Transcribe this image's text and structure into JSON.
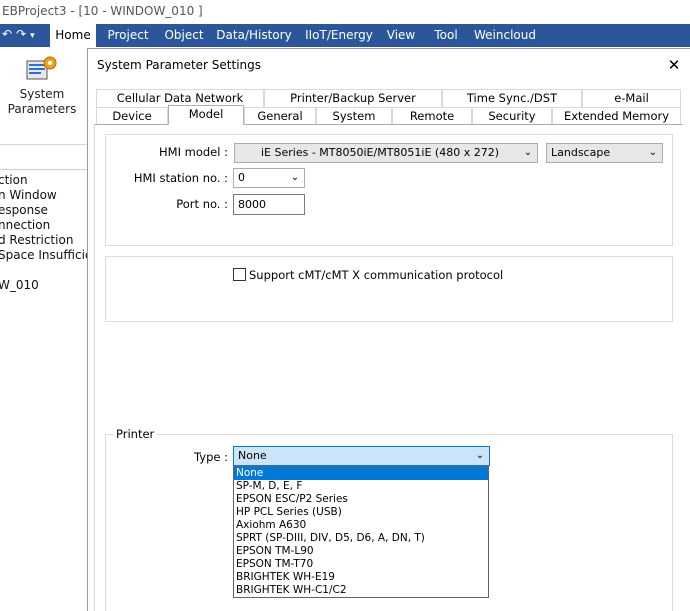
{
  "window": {
    "title": "EBProject3 - [10 - WINDOW_010 ]"
  },
  "quick_access": {
    "icons": [
      "undo-icon",
      "redo-icon",
      "customize-icon"
    ]
  },
  "ribbon": {
    "tabs": [
      {
        "label": "Home",
        "active": true
      },
      {
        "label": "Project"
      },
      {
        "label": "Object"
      },
      {
        "label": "Data/History"
      },
      {
        "label": "IIoT/Energy"
      },
      {
        "label": "View"
      },
      {
        "label": "Tool"
      },
      {
        "label": "Weincloud"
      }
    ],
    "system_parameters_label": "System\nParameters"
  },
  "left_panel": {
    "items": [
      "ction",
      "n Window",
      "esponse",
      "nnection",
      "d Restriction",
      "Space Insufficient",
      "",
      "W_010"
    ]
  },
  "dialog": {
    "title": "System Parameter Settings",
    "close_glyph": "✕",
    "tabs_row1": [
      "Cellular Data Network",
      "Printer/Backup Server",
      "Time Sync./DST",
      "e-Mail"
    ],
    "tabs_row2": [
      "Device",
      "Model",
      "General",
      "System",
      "Remote",
      "Security",
      "Extended Memory"
    ],
    "active_tab": "Model",
    "hmi_model": {
      "label": "HMI model :",
      "value": "iE Series - MT8050iE/MT8051iE (480 x 272)",
      "orientation": "Landscape"
    },
    "hmi_station": {
      "label": "HMI station no. :",
      "value": "0"
    },
    "port": {
      "label": "Port no. :",
      "value": "8000"
    },
    "cmt_support": {
      "label": "Support cMT/cMT X communication protocol",
      "checked": false
    },
    "printer": {
      "legend": "Printer",
      "type_label": "Type :",
      "selected": "None",
      "options": [
        "None",
        "SP-M, D, E, F",
        "EPSON ESC/P2 Series",
        "HP PCL Series (USB)",
        "Axiohm A630",
        "SPRT (SP-DIII, DIV, D5, D6, A, DN, T)",
        "EPSON TM-L90",
        "EPSON TM-T70",
        "BRIGHTEK WH-E19",
        "BRIGHTEK WH-C1/C2"
      ]
    }
  },
  "colors": {
    "ribbon_blue": "#2b579a",
    "selection_blue": "#0078d7"
  }
}
